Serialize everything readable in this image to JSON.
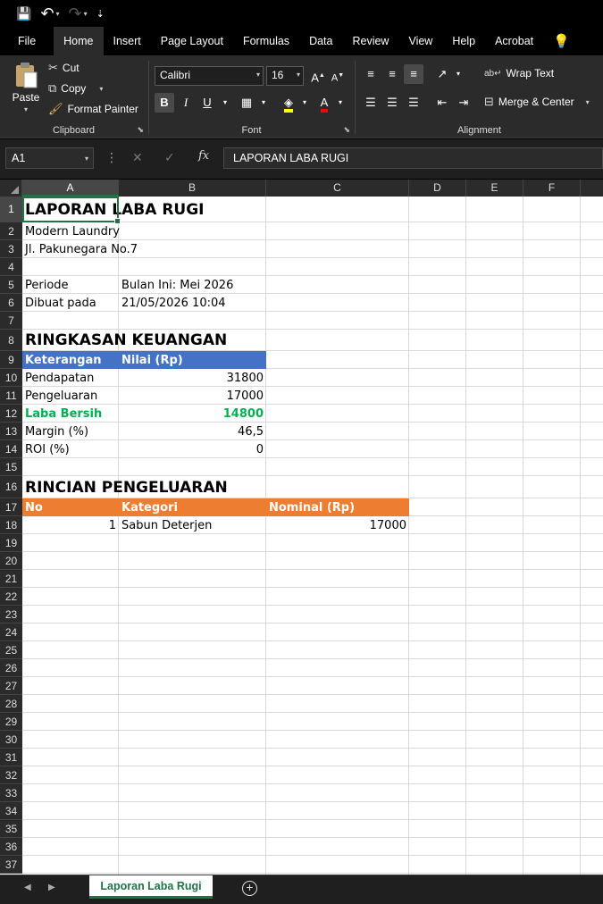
{
  "qat": {
    "save": "💾",
    "undo": "↶",
    "redo": "↷",
    "more": "⇣"
  },
  "menu": [
    "File",
    "Home",
    "Insert",
    "Page Layout",
    "Formulas",
    "Data",
    "Review",
    "View",
    "Help",
    "Acrobat"
  ],
  "ribbon": {
    "clipboard": {
      "label": "Clipboard",
      "paste": "Paste",
      "cut": "Cut",
      "copy": "Copy",
      "format_painter": "Format Painter"
    },
    "font": {
      "label": "Font",
      "name": "Calibri",
      "size": "16",
      "bold": "B",
      "italic": "I",
      "underline": "U"
    },
    "alignment": {
      "label": "Alignment",
      "wrap": "Wrap Text",
      "merge": "Merge & Center"
    }
  },
  "formula_bar": {
    "name_box": "A1",
    "fx": "fx",
    "value": "LAPORAN LABA RUGI"
  },
  "columns": [
    "A",
    "B",
    "C",
    "D",
    "E",
    "F"
  ],
  "rows": [
    "1",
    "2",
    "3",
    "4",
    "5",
    "6",
    "7",
    "8",
    "9",
    "10",
    "11",
    "12",
    "13",
    "14",
    "15",
    "16",
    "17",
    "18",
    "19",
    "20",
    "21",
    "22",
    "23",
    "24",
    "25",
    "26",
    "27",
    "28",
    "29",
    "30",
    "31",
    "32",
    "33",
    "34",
    "35",
    "36",
    "37"
  ],
  "cells": {
    "a1": "LAPORAN LABA RUGI",
    "a2": "Modern Laundry",
    "a3": "Jl. Pakunegara No.7",
    "a5": "Periode",
    "b5": "Bulan Ini: Mei 2026",
    "a6": "Dibuat pada",
    "b6": "21/05/2026 10:04",
    "a8": "RINGKASAN KEUANGAN",
    "a9": "Keterangan",
    "b9": "Nilai (Rp)",
    "a10": "Pendapatan",
    "b10": "31800",
    "a11": "Pengeluaran",
    "b11": "17000",
    "a12": "Laba Bersih",
    "b12": "14800",
    "a13": "Margin (%)",
    "b13": "46,5",
    "a14": "ROI (%)",
    "b14": "0",
    "a16": "RINCIAN PENGELUARAN",
    "a17": "No",
    "b17": "Kategori",
    "c17": "Nominal (Rp)",
    "a18": "1",
    "b18": "Sabun Deterjen",
    "c18": "17000"
  },
  "colors": {
    "summary_header": "#4472c4",
    "detail_header": "#ed7d31",
    "profit": "#00b050",
    "selection": "#217346"
  },
  "sheet": {
    "tab": "Laporan Laba Rugi",
    "add": "+"
  }
}
